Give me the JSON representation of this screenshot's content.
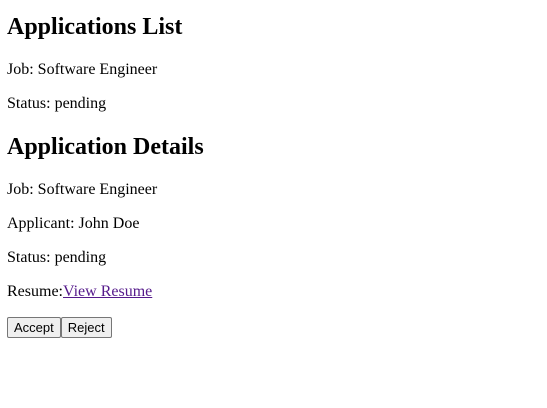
{
  "list": {
    "heading": "Applications List",
    "items": [
      {
        "job": "Job: Software Engineer",
        "status": "Status: pending"
      }
    ]
  },
  "details": {
    "heading": "Application Details",
    "job": "Job: Software Engineer",
    "applicant": "Applicant: John Doe",
    "status": "Status: pending",
    "resume_label": "Resume:",
    "resume_link_text": "View Resume",
    "accept_label": "Accept",
    "reject_label": "Reject"
  },
  "colors": {
    "link_visited": "#551a8b",
    "button_bg": "#efefef",
    "button_border": "#767676"
  }
}
